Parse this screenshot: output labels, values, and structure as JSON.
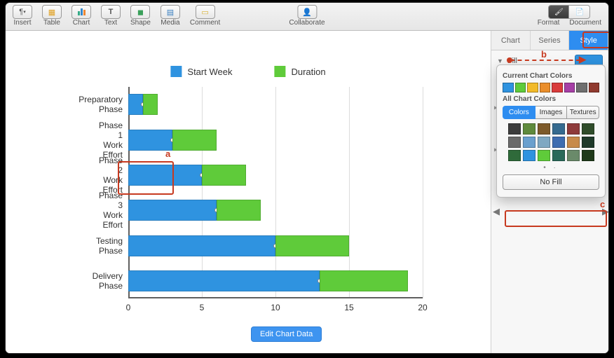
{
  "toolbar": {
    "items": [
      {
        "name": "insert",
        "label": "Insert",
        "icon": "¶"
      },
      {
        "name": "table",
        "label": "Table",
        "icon": "▦"
      },
      {
        "name": "chart",
        "label": "Chart",
        "icon": "▮"
      },
      {
        "name": "text",
        "label": "Text",
        "icon": "T"
      },
      {
        "name": "shape",
        "label": "Shape",
        "icon": "◼"
      },
      {
        "name": "media",
        "label": "Media",
        "icon": "▤"
      },
      {
        "name": "comment",
        "label": "Comment",
        "icon": "▭"
      }
    ],
    "collaborate": {
      "label": "Collaborate",
      "icon": "👤"
    },
    "format": {
      "label": "Format",
      "icon": "🖌"
    },
    "document": {
      "label": "Document",
      "icon": "📄"
    }
  },
  "legend": {
    "series": [
      {
        "name": "Start Week",
        "color": "#2f93e0"
      },
      {
        "name": "Duration",
        "color": "#5fcb3a"
      }
    ]
  },
  "chart_data": {
    "type": "bar",
    "orientation": "horizontal",
    "stacked": true,
    "categories": [
      "Preparatory Phase",
      "Phase 1 Work Effort",
      "Phase 2 Work Effort",
      "Phase 3 Work Effort",
      "Testing Phase",
      "Delivery Phase"
    ],
    "series": [
      {
        "name": "Start Week",
        "color": "#2f93e0",
        "values": [
          1,
          3,
          5,
          6,
          10,
          13
        ]
      },
      {
        "name": "Duration",
        "color": "#5fcb3a",
        "values": [
          1,
          3,
          3,
          3,
          5,
          6
        ]
      }
    ],
    "xlabel": "",
    "ylabel": "",
    "xlim": [
      0,
      20
    ],
    "xticks": [
      0,
      5,
      10,
      15,
      20
    ]
  },
  "edit_button": "Edit Chart Data",
  "sidepanel": {
    "tabs": [
      "Chart",
      "Series",
      "Style"
    ],
    "active_tab": "Style",
    "fill_label": "Fill",
    "fill_swatch_color": "#2f93e0",
    "popover": {
      "current_label": "Current Chart Colors",
      "current_colors": [
        "#2f93e0",
        "#5fcb3a",
        "#f2ba2a",
        "#ea8e2b",
        "#d93b3b",
        "#a63fa6",
        "#6f6f6f",
        "#903a2f"
      ],
      "all_label": "All Chart Colors",
      "seg_tabs": [
        "Colors",
        "Images",
        "Textures"
      ],
      "seg_active": "Colors",
      "all_colors": [
        "#3c3c3c",
        "#5f8a3c",
        "#7d5a2a",
        "#356a8f",
        "#8e3a3a",
        "#2f4c2a",
        "#6a6a6a",
        "#6aa0ce",
        "#7fa8c2",
        "#3e6db0",
        "#c78a4a",
        "#1f3a2a",
        "#2f6a3a",
        "#2f93e0",
        "#5fcb3a",
        "#2a6a5a",
        "#6a8a6a",
        "#1f3a1a"
      ],
      "nofill_label": "No Fill"
    }
  },
  "annotations": {
    "a": "a",
    "b": "b",
    "c": "c"
  }
}
